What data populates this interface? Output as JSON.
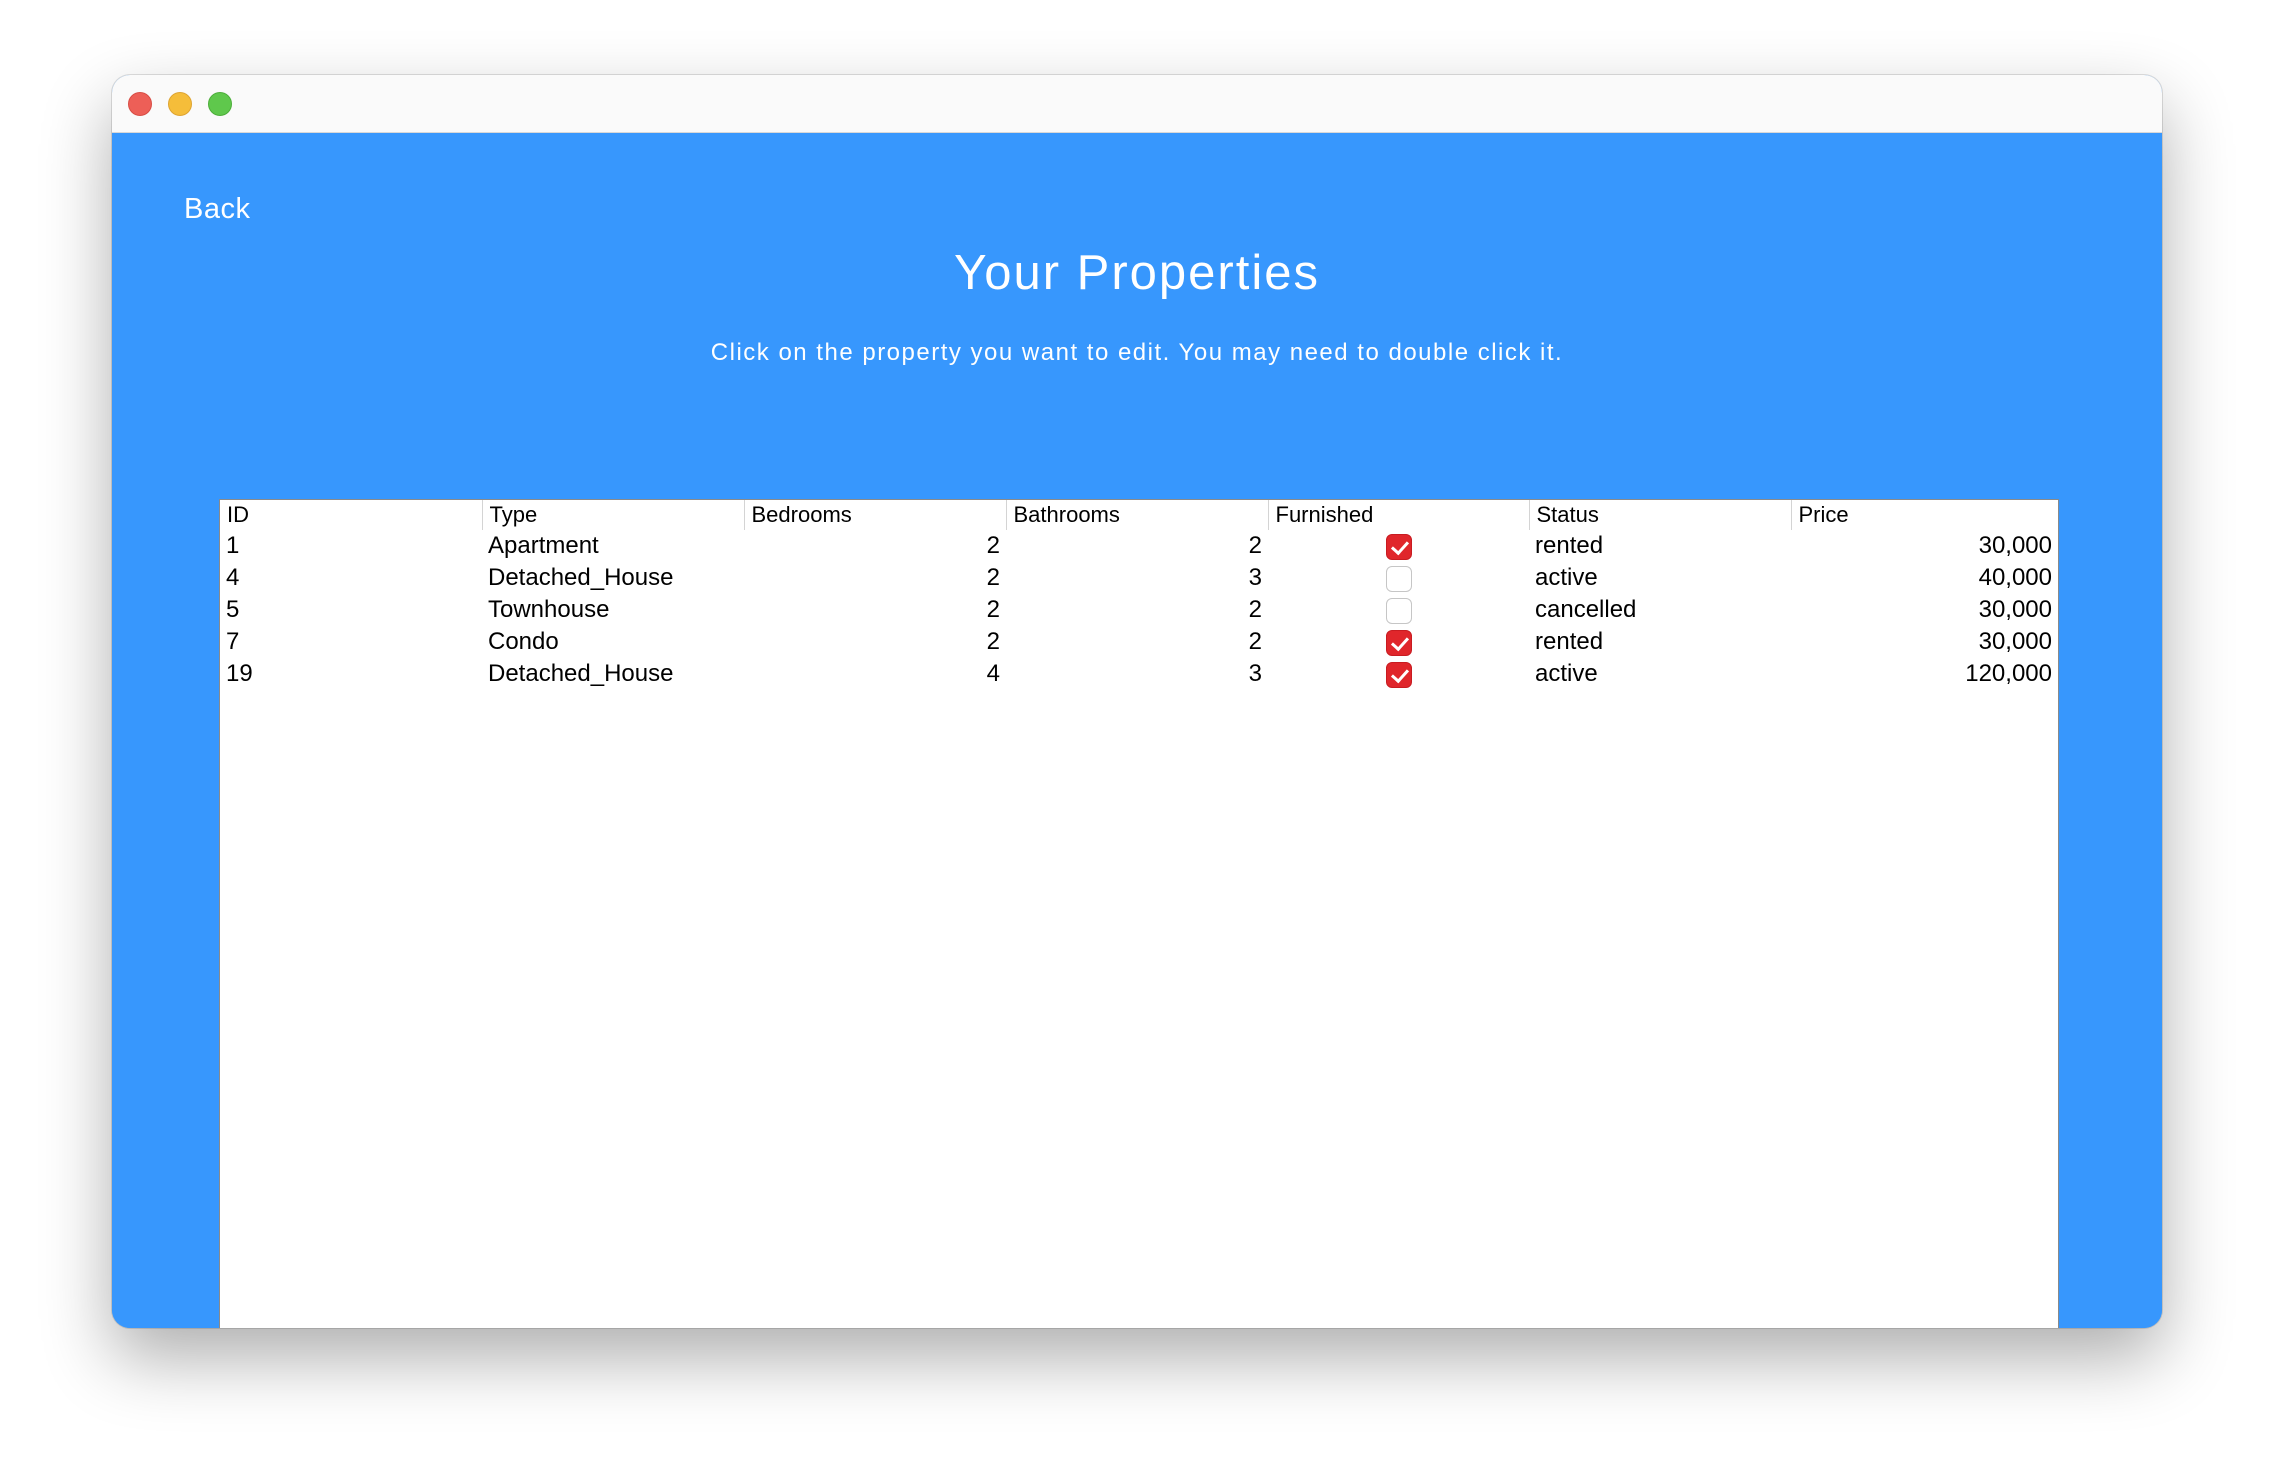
{
  "window": {
    "controls": [
      "close",
      "minimize",
      "zoom"
    ]
  },
  "nav": {
    "back_label": "Back"
  },
  "header": {
    "title": "Your Properties",
    "subtitle": "Click on the property you want to edit. You may need to double click it."
  },
  "table": {
    "columns": [
      "ID",
      "Type",
      "Bedrooms",
      "Bathrooms",
      "Furnished",
      "Status",
      "Price"
    ],
    "rows": [
      {
        "id": "1",
        "type": "Apartment",
        "bedrooms": "2",
        "bathrooms": "2",
        "furnished": true,
        "status": "rented",
        "price": "30,000"
      },
      {
        "id": "4",
        "type": "Detached_House",
        "bedrooms": "2",
        "bathrooms": "3",
        "furnished": false,
        "status": "active",
        "price": "40,000"
      },
      {
        "id": "5",
        "type": "Townhouse",
        "bedrooms": "2",
        "bathrooms": "2",
        "furnished": false,
        "status": "cancelled",
        "price": "30,000"
      },
      {
        "id": "7",
        "type": "Condo",
        "bedrooms": "2",
        "bathrooms": "2",
        "furnished": true,
        "status": "rented",
        "price": "30,000"
      },
      {
        "id": "19",
        "type": "Detached_House",
        "bedrooms": "4",
        "bathrooms": "3",
        "furnished": true,
        "status": "active",
        "price": "120,000"
      }
    ]
  },
  "colors": {
    "background": "#3797fd",
    "checkbox_checked": "#e0262b",
    "text_on_background": "#ffffff"
  }
}
